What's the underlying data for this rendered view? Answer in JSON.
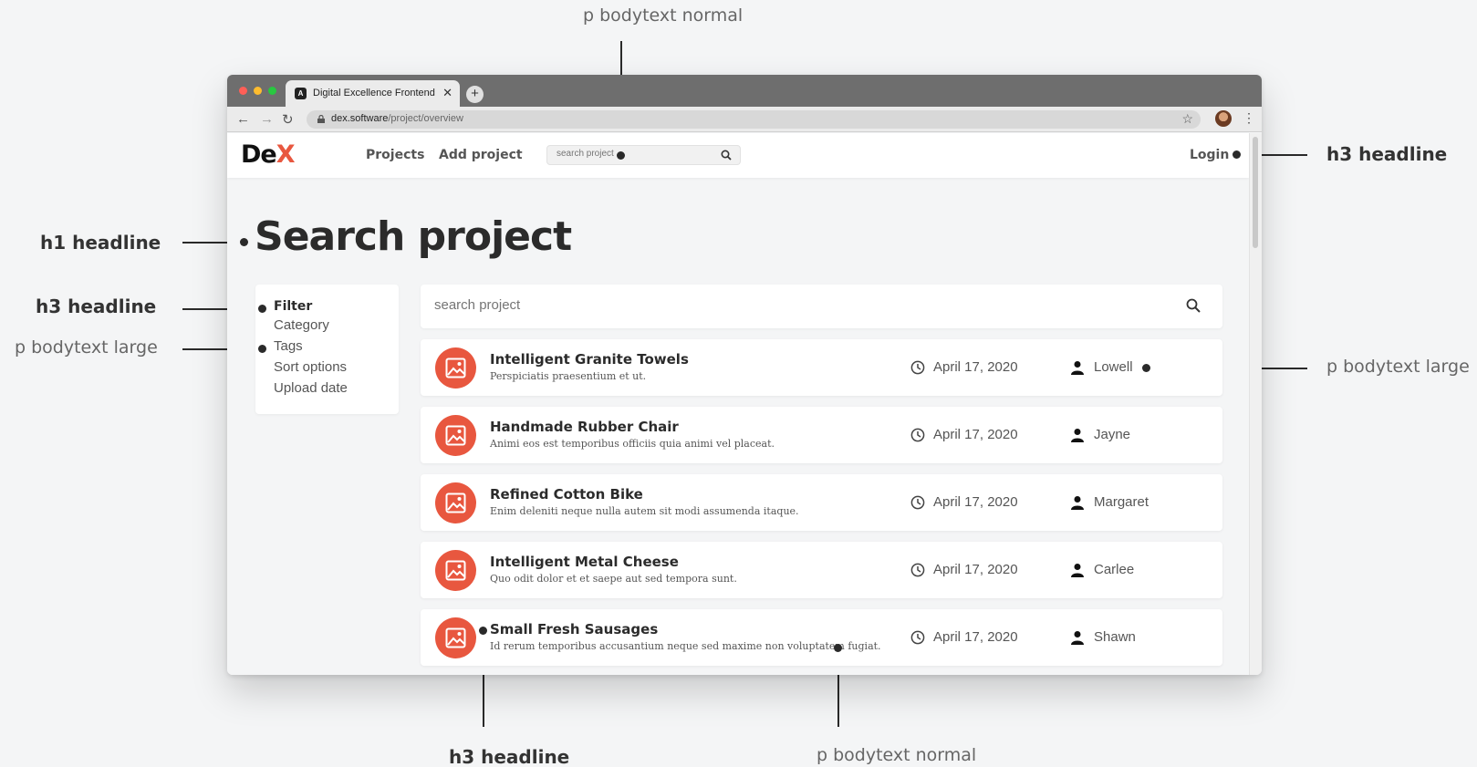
{
  "annotations": {
    "top_center": "p bodytext normal",
    "right_top": "h3 headline",
    "left_h1": "h1 headline",
    "left_h3": "h3 headline",
    "left_p": "p bodytext large",
    "right_p": "p bodytext large",
    "bottom_h3": "h3 headline",
    "bottom_p": "p bodytext normal"
  },
  "browser": {
    "tab_title": "Digital Excellence Frontend",
    "url_host": "dex.software",
    "url_path": "/project/overview"
  },
  "app": {
    "logo_main": "De",
    "logo_accent": "X",
    "nav": {
      "projects": "Projects",
      "add_project": "Add project",
      "search_placeholder": "search project",
      "login": "Login"
    },
    "page_title": "Search project",
    "filter": {
      "title": "Filter",
      "items": [
        "Category",
        "Tags",
        "Sort options",
        "Upload date"
      ]
    },
    "search_placeholder": "search project",
    "projects": [
      {
        "title": "Intelligent Granite Towels",
        "description": "Perspiciatis praesentium et ut.",
        "date": "April 17, 2020",
        "author": "Lowell"
      },
      {
        "title": "Handmade Rubber Chair",
        "description": "Animi eos est temporibus officiis quia animi vel placeat.",
        "date": "April 17, 2020",
        "author": "Jayne"
      },
      {
        "title": "Refined Cotton Bike",
        "description": "Enim deleniti neque nulla autem sit modi assumenda itaque.",
        "date": "April 17, 2020",
        "author": "Margaret"
      },
      {
        "title": "Intelligent Metal Cheese",
        "description": "Quo odit dolor et et saepe aut sed tempora sunt.",
        "date": "April 17, 2020",
        "author": "Carlee"
      },
      {
        "title": "Small Fresh Sausages",
        "description": "Id rerum temporibus accusantium neque sed maxime non voluptatem fugiat.",
        "date": "April 17, 2020",
        "author": "Shawn"
      }
    ]
  },
  "colors": {
    "accent": "#e8573f",
    "background": "#f4f5f6",
    "text_dark": "#2b2b2b"
  }
}
